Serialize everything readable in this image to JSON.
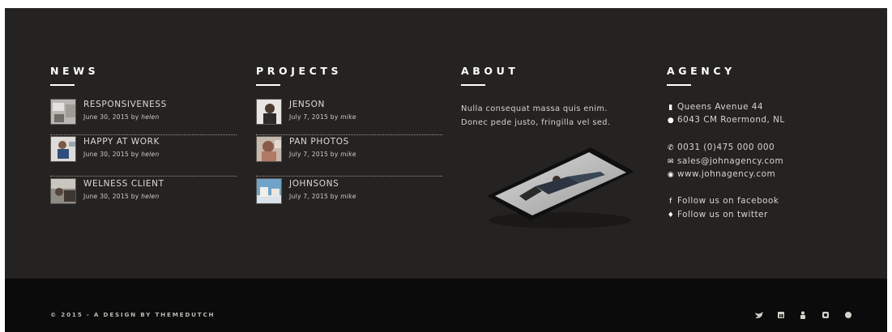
{
  "news": {
    "title": "NEWS",
    "items": [
      {
        "title": "RESPONSIVENESS",
        "date": "June 30, 2015 by",
        "author": "helen"
      },
      {
        "title": "HAPPY AT WORK",
        "date": "June 30, 2015 by",
        "author": "helen"
      },
      {
        "title": "WELNESS CLIENT",
        "date": "June 30, 2015 by",
        "author": "helen"
      }
    ]
  },
  "projects": {
    "title": "PROJECTS",
    "items": [
      {
        "title": "JENSON",
        "date": "July 7, 2015 by",
        "author": "mike"
      },
      {
        "title": "PAN PHOTOS",
        "date": "July 7, 2015 by",
        "author": "mike"
      },
      {
        "title": "JOHNSONS",
        "date": "July 7, 2015 by",
        "author": "mike"
      }
    ]
  },
  "about": {
    "title": "ABOUT",
    "text_line1": "Nulla consequat massa quis enim.",
    "text_line2": "Donec pede justo, fringilla vel sed."
  },
  "agency": {
    "title": "AGENCY",
    "address_line1": "Queens Avenue 44",
    "address_line2": "6043 CM Roermond, NL",
    "phone": "0031 (0)475 000 000",
    "email": "sales@johnagency.com",
    "website": "www.johnagency.com",
    "facebook": "Follow us on facebook",
    "twitter": "Follow us on twitter"
  },
  "footer": {
    "copyright": "© 2015 - A DESIGN BY THEMEDUTCH",
    "social_icons": [
      "twitter-icon",
      "linkedin-icon",
      "user-icon",
      "instagram-icon",
      "dribbble-icon"
    ]
  },
  "colors": {
    "footer_top_bg": "#252321",
    "footer_bottom_bg": "#0b0b0b",
    "heading": "#ffffff",
    "text": "#d8d4cf"
  }
}
